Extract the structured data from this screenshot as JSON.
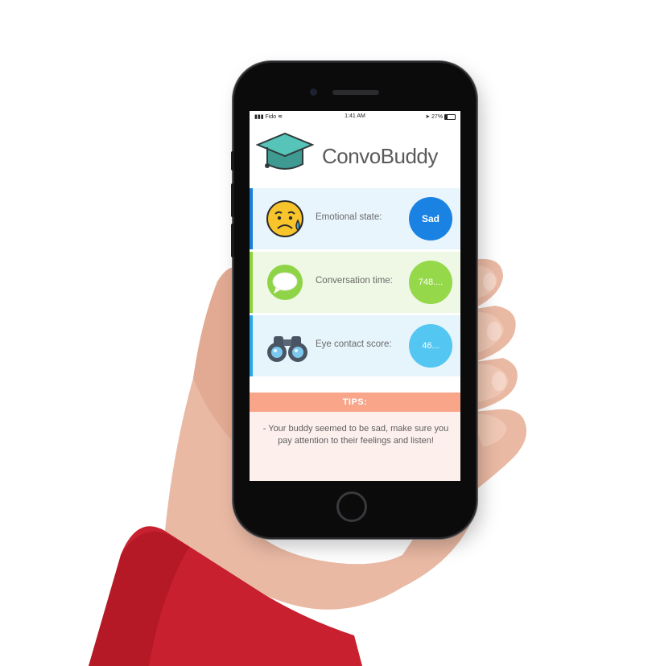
{
  "status_bar": {
    "carrier": "Fido",
    "time": "1:41 AM",
    "battery": "27%",
    "battery_level": 0.27
  },
  "app": {
    "title": "ConvoBuddy",
    "icon": "graduation-cap-icon"
  },
  "stats": [
    {
      "label": "Emotional state:",
      "value": "Sad",
      "icon": "sad-face-icon",
      "accent_color": "#1a7fd8",
      "row_bg": "#e9f5fd",
      "circle_color": "#1a82e2"
    },
    {
      "label": "Conversation time:",
      "value": "748....",
      "icon": "chat-bubble-icon",
      "accent_color": "#8ed23c",
      "row_bg": "#eef8e5",
      "circle_color": "#95d84a"
    },
    {
      "label": "Eye contact score:",
      "value": "46...",
      "icon": "binoculars-icon",
      "accent_color": "#2ca8e8",
      "row_bg": "#e6f4fc",
      "circle_color": "#54c6f2"
    }
  ],
  "tips": {
    "header": "TIPS:",
    "text": "- Your buddy seemed to be sad, make sure you pay attention to their feelings and listen!",
    "header_color": "#f8a58a",
    "body_color": "#fdf0ec"
  },
  "colors": {
    "sleeve": "#c8202f",
    "skin": "#e9b9a3"
  }
}
